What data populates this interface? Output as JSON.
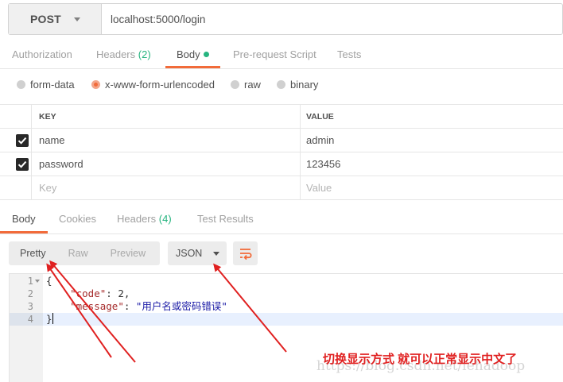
{
  "request": {
    "method": "POST",
    "url": "localhost:5000/login"
  },
  "request_tabs": [
    {
      "label": "Authorization",
      "count": ""
    },
    {
      "label": "Headers",
      "count": "(2)"
    },
    {
      "label": "Body",
      "count": ""
    },
    {
      "label": "Pre-request Script",
      "count": ""
    },
    {
      "label": "Tests",
      "count": ""
    }
  ],
  "body_types": [
    "form-data",
    "x-www-form-urlencoded",
    "raw",
    "binary"
  ],
  "body_type_selected": "x-www-form-urlencoded",
  "kv_table": {
    "columns": [
      "KEY",
      "VALUE"
    ],
    "rows": [
      {
        "checked": true,
        "key": "name",
        "value": "admin"
      },
      {
        "checked": true,
        "key": "password",
        "value": "123456"
      }
    ],
    "placeholder_key": "Key",
    "placeholder_value": "Value"
  },
  "response_tabs": [
    {
      "label": "Body",
      "count": ""
    },
    {
      "label": "Cookies",
      "count": ""
    },
    {
      "label": "Headers",
      "count": "(4)"
    },
    {
      "label": "Test Results",
      "count": ""
    }
  ],
  "response_view": {
    "modes": [
      "Pretty",
      "Raw",
      "Preview"
    ],
    "active_mode": "Pretty",
    "format": "JSON"
  },
  "editor": {
    "line_numbers": [
      "1",
      "2",
      "3",
      "4"
    ],
    "open_brace": "{",
    "code_key": "\"code\"",
    "code_value": "2",
    "message_key": "\"message\"",
    "message_value": "\"用户名或密码错误\"",
    "close_brace": "}"
  },
  "annotation": "切换显示方式 就可以正常显示中文了",
  "watermark": "https://blog.csdn.net/lehadoop",
  "colors": {
    "accent": "#f26b3a",
    "count_green": "#26b47f",
    "arrow_red": "#e02020"
  }
}
